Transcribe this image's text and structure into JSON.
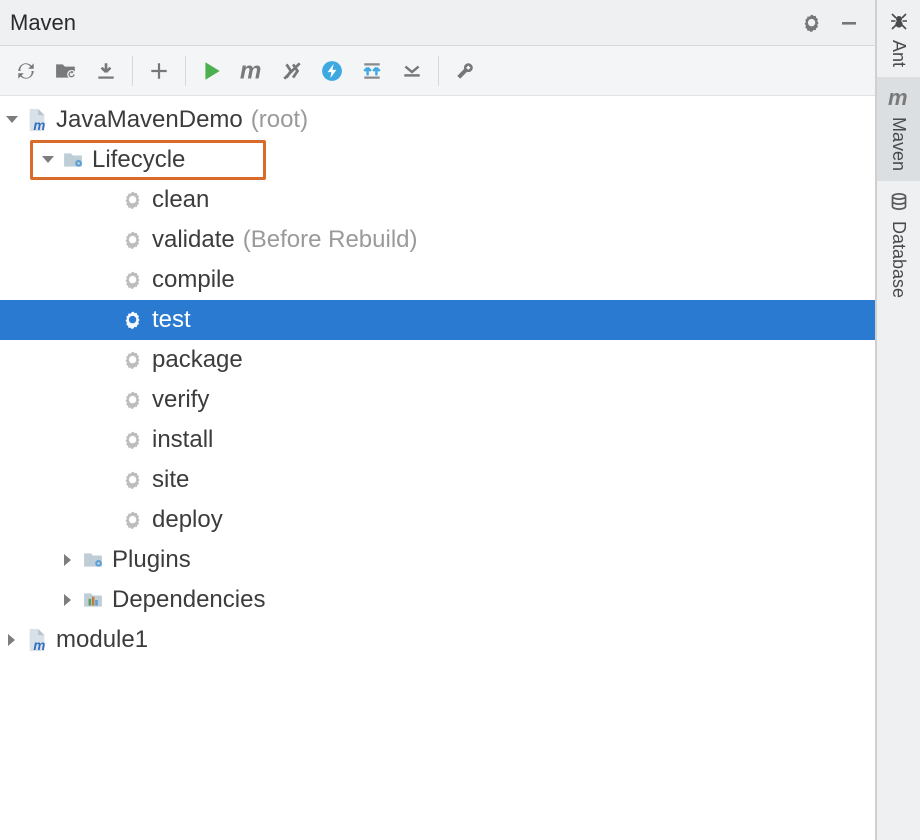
{
  "titlebar": {
    "title": "Maven"
  },
  "tree": {
    "project": {
      "name": "JavaMavenDemo",
      "suffix": "(root)"
    },
    "lifecycle_label": "Lifecycle",
    "lifecycle": [
      {
        "name": "clean",
        "hint": ""
      },
      {
        "name": "validate",
        "hint": "(Before Rebuild)"
      },
      {
        "name": "compile",
        "hint": ""
      },
      {
        "name": "test",
        "hint": "",
        "selected": true
      },
      {
        "name": "package",
        "hint": ""
      },
      {
        "name": "verify",
        "hint": ""
      },
      {
        "name": "install",
        "hint": ""
      },
      {
        "name": "site",
        "hint": ""
      },
      {
        "name": "deploy",
        "hint": ""
      }
    ],
    "plugins_label": "Plugins",
    "dependencies_label": "Dependencies",
    "module2": "module1"
  },
  "side": {
    "ant": "Ant",
    "maven": "Maven",
    "database": "Database"
  }
}
